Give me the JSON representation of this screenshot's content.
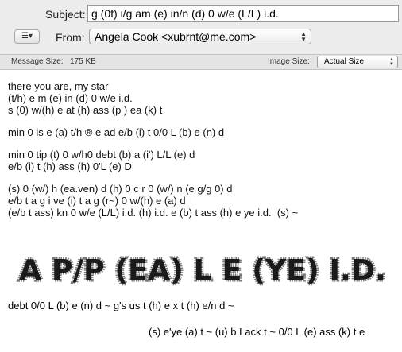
{
  "header": {
    "subject_label": "Subject:",
    "subject_value": "g (0f) i/g am (e) in/n (d) 0 w/e (L/L) i.d.",
    "list_button_icon": "list-menu-icon",
    "from_label": "From:",
    "from_value": "Angela Cook <xubrnt@me.com>"
  },
  "infobar": {
    "message_size_label": "Message Size:",
    "message_size_value": "175 KB",
    "image_size_label": "Image Size:",
    "image_size_value": "Actual Size"
  },
  "body": {
    "lines": [
      "there you are, my star",
      "(t/h) e m (e) in (d) 0 w/e i.d.",
      "s (0) w/(h) e at (h) ass (p ) ea (k) t",
      "",
      "min 0 is e (a) t/h ® e ad e/b (i) t 0/0 L (b) e (n) d",
      "",
      "min 0 tip (t) 0 w/h0 debt (b) a (i') L/L (e) d",
      "e/b (i) t (h) ass (h) 0'L (e) D",
      "",
      "(s) 0 (w/) h (ea.ven) d (h) 0 c r 0 (w/) n (e g/g 0) d",
      "e/b t a g i ve (i) t a g (r~) 0 w/(h) e (a) d",
      "(e/b t ass) kn 0 w/e (L/L) i.d. (h) i.d. e (b) t ass (h) e ye i.d.  (s) ~"
    ],
    "banner_text": "A P/P (EA) L E (YE) I.D.",
    "closing_line_1": "debt 0/0 L (b) e (n) d ~ g's us t (h) e x t (h) e/n d ~",
    "closing_line_2": "(s) e'ye (a) t ~ (u) b Lack t ~ 0/0 L (e) ass (k) t e"
  }
}
